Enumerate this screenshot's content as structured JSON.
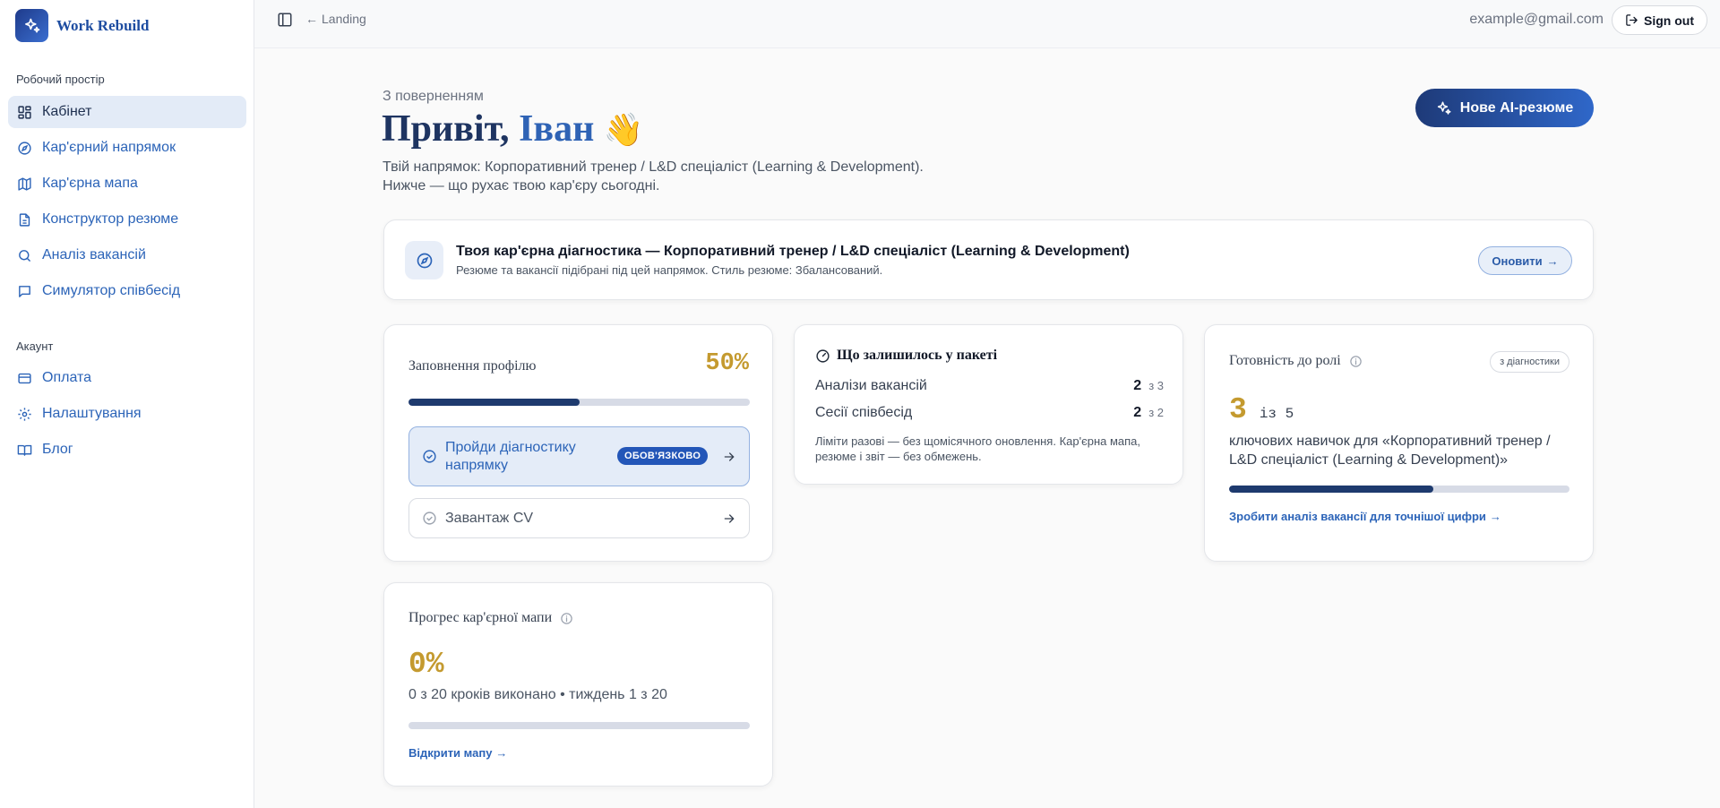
{
  "brand": {
    "name": "Work Rebuild",
    "logo_icon": "sparkles-icon"
  },
  "sidebar": {
    "workspace_title": "Робочий простір",
    "workspace_items": [
      {
        "label": "Кабінет",
        "icon": "dashboard-grid-icon",
        "active": true
      },
      {
        "label": "Кар'єрний напрямок",
        "icon": "compass-icon"
      },
      {
        "label": "Кар'єрна мапа",
        "icon": "map-icon"
      },
      {
        "label": "Конструктор резюме",
        "icon": "document-icon"
      },
      {
        "label": "Аналіз вакансій",
        "icon": "search-icon"
      },
      {
        "label": "Симулятор співбесід",
        "icon": "chat-icon"
      }
    ],
    "account_title": "Акаунт",
    "account_items": [
      {
        "label": "Оплата",
        "icon": "credit-card-icon"
      },
      {
        "label": "Налаштування",
        "icon": "gear-icon"
      },
      {
        "label": "Блог",
        "icon": "book-icon"
      }
    ]
  },
  "topbar": {
    "back_label": "Landing",
    "email": "example@gmail.com",
    "signout_label": "Sign out"
  },
  "hero": {
    "eyebrow": "З поверненням",
    "greeting": "Привіт,",
    "name": "Іван",
    "emoji": "👋",
    "subtitle_line1": "Твій напрямок: Корпоративний тренер / L&D спеціаліст (Learning & Development).",
    "subtitle_line2": "Нижче — що рухає твою кар'єру сьогодні.",
    "new_resume_label": "Нове AI-резюме"
  },
  "diagnostics": {
    "title": "Твоя кар'єрна діагностика — Корпоративний тренер / L&D спеціаліст (Learning & Development)",
    "subtitle": "Резюме та вакансії підібрані під цей напрямок. Стиль резюме: Збалансований.",
    "refresh_label": "Оновити"
  },
  "profile": {
    "title": "Заповнення профілю",
    "percent_label": "50%",
    "progress": 0.5,
    "tasks": [
      {
        "label": "Пройди діагностику напрямку",
        "badge": "ОБОВ'ЯЗКОВО"
      },
      {
        "label": "Завантаж CV"
      }
    ]
  },
  "package": {
    "title": "Що залишилось у пакеті",
    "rows": [
      {
        "label": "Аналізи вакансій",
        "count": "2",
        "of": "з 3"
      },
      {
        "label": "Сесії співбесід",
        "count": "2",
        "of": "з 2"
      }
    ],
    "note": "Ліміти разові — без щомісячного оновлення. Кар'єрна мапа, резюме і звіт — без обмежень."
  },
  "readiness": {
    "title": "Готовність до ролі",
    "tag": "з діагностики",
    "count": "3",
    "of": "із 5",
    "description": "ключових навичок для «Корпоративний тренер / L&D спеціаліст (Learning & Development)»",
    "progress": 0.6,
    "link_label": "Зробити аналіз вакансії для точнішої цифри"
  },
  "career_map": {
    "title": "Прогрес кар'єрної мапи",
    "percent_label": "0%",
    "steps_label": "0 з 20 кроків виконано • тиждень 1 з 20",
    "progress": 0,
    "link_label": "Відкрити мапу"
  },
  "colors": {
    "accent": "#1e3a6e",
    "link": "#2c64b8",
    "gold": "#c49a2f"
  }
}
